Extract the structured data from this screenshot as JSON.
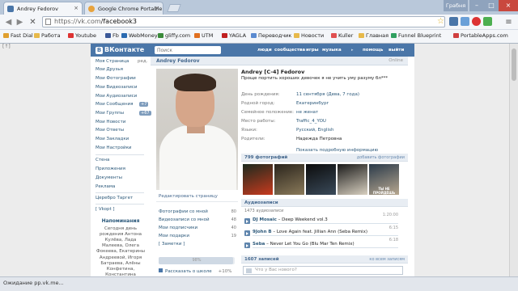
{
  "browser": {
    "tabs": [
      {
        "title": "Andrey Fedorov",
        "active": true
      },
      {
        "title": "Google Chrome Portable",
        "active": false
      }
    ],
    "user_label": "Грабня",
    "url": "https://vk.com/facebook3",
    "url_host": "https://vk.com",
    "url_path": "/facebook3",
    "left_stub": "[↑]",
    "bookmarks": [
      "Fast Dial",
      "Работа",
      "Youtube",
      "Fb",
      "WebMoney",
      "gliffy.com",
      "UTM",
      "YAGLA",
      "Переводчик",
      "Новости",
      "Kuller",
      "Главная",
      "Funnel Blueprint",
      "PortableApps.com"
    ],
    "status": "Ожидание pp.vk.me..."
  },
  "vk": {
    "logo": "ВКонтакте",
    "search_placeholder": "Поиск",
    "nav": [
      "люди",
      "сообщества",
      "игры",
      "музыка",
      "помощь",
      "выйти"
    ],
    "sidebar": {
      "items": [
        {
          "label": "Моя Страница",
          "extra": "ред."
        },
        {
          "label": "Мои Друзья"
        },
        {
          "label": "Мои Фотографии"
        },
        {
          "label": "Мои Видеозаписи"
        },
        {
          "label": "Мои Аудиозаписи"
        },
        {
          "label": "Мои Сообщения",
          "count": "+7"
        },
        {
          "label": "Мои Группы",
          "count": "+67"
        },
        {
          "label": "Мои Новости"
        },
        {
          "label": "Мои Ответы"
        },
        {
          "label": "Мои Закладки"
        },
        {
          "label": "Мои Настройки"
        }
      ],
      "apps": [
        "Стена",
        "Приложения",
        "Документы",
        "Реклама",
        "Церебро Таргет",
        "[ Vkopt ]"
      ],
      "reminder_title": "Напоминания",
      "reminder_text": "Сегодня день рождения Антона Кулёва, Лада Малеева, Олега Фокеева, Екатерины Андреевой, Игоря Батраева, Алёны Конфетина, Константина"
    },
    "profile": {
      "header_name": "Andrey Fedorov",
      "online": "Online",
      "name": "Andrey [C-4] Fedorov",
      "status": "Проще портить хороших девочек я не учить уму разуму бл***",
      "info": [
        {
          "label": "День рождения:",
          "value": "11 сентября (Дева, 7 года)"
        },
        {
          "label": "Родной город:",
          "value": "Екатеринбург"
        },
        {
          "label": "Семейное положение:",
          "value": "не женат"
        },
        {
          "label": "Место работы:",
          "value": "Traffic_4_YOU"
        },
        {
          "label": "Языки:",
          "value": "Русский, English"
        },
        {
          "label": "Родители:",
          "value": "Надежда Петровна"
        }
      ],
      "more_info": "Показать подробную информацию",
      "edit_page": "Редактировать страницу",
      "links": [
        {
          "label": "Фотографии со мной",
          "count": "80"
        },
        {
          "label": "Видеозаписи со мной",
          "count": "48"
        },
        {
          "label": "Мои подписчики",
          "count": "40"
        },
        {
          "label": "Мои подарки",
          "count": "19"
        },
        {
          "label": "[ Заметки ]",
          "count": ""
        }
      ],
      "progress_label": "98%",
      "progress_value": 0.98,
      "tell_school": "Рассказать о школе",
      "tell_value": "+10%"
    },
    "photos": {
      "title": "799 фотографий",
      "action": "добавить фотографии",
      "thumbs": [
        {
          "colors": [
            "#1c2a1e",
            "#c83a1e"
          ]
        },
        {
          "colors": [
            "#2a241c",
            "#8a7a5a"
          ]
        },
        {
          "colors": [
            "#0c0c0c",
            "#3a4a5a"
          ]
        },
        {
          "colors": [
            "#1a1a1a",
            "#d8d0c0"
          ]
        },
        {
          "colors": [
            "#2a3a4a",
            "#b8a890"
          ]
        },
        {
          "colors": [
            "#14202a",
            "#58708a"
          ]
        }
      ],
      "thumb_caption": "ТЫ НЕ ПРОЙДЁШЬ"
    },
    "audio": {
      "title": "Аудиозаписи",
      "count": "1473 аудиозаписи",
      "action": "",
      "tracks": [
        {
          "artist": "DJ Mosaic",
          "title": "Deep Weekend vol.3",
          "duration": "1:20:00"
        },
        {
          "artist": "9John B",
          "title": "Love Again feat. Jillian Ann (Seba Remix)",
          "duration": "6:15"
        },
        {
          "artist": "Seba",
          "title": "Never Let You Go (Blu Mar Ten Remix)",
          "duration": "6:18"
        }
      ]
    },
    "wall": {
      "title": "1607 записей",
      "action": "ко всем записям",
      "placeholder": "Что у Вас нового?"
    }
  }
}
